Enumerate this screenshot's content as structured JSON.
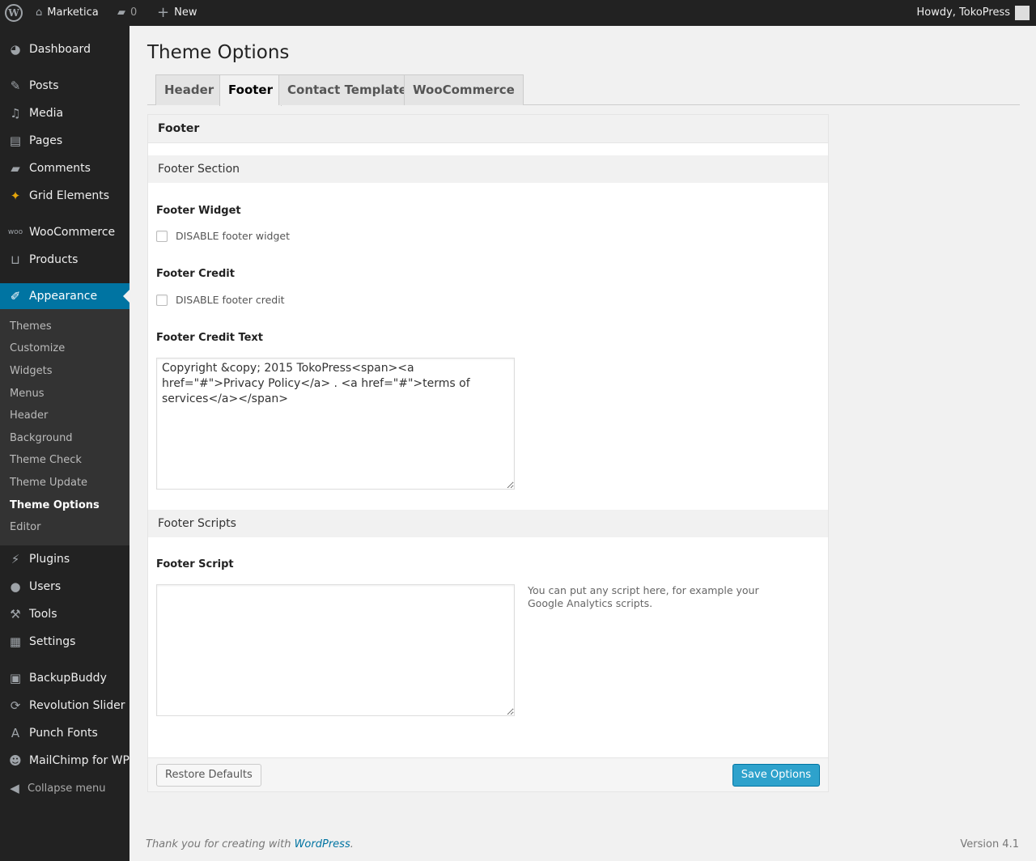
{
  "adminbar": {
    "site": "Marketica",
    "comments": "0",
    "new": "New",
    "howdy": "Howdy, TokoPress"
  },
  "menu": {
    "dashboard": "Dashboard",
    "posts": "Posts",
    "media": "Media",
    "pages": "Pages",
    "comments": "Comments",
    "grid": "Grid Elements",
    "woocommerce": "WooCommerce",
    "products": "Products",
    "appearance": "Appearance",
    "plugins": "Plugins",
    "users": "Users",
    "tools": "Tools",
    "settings": "Settings",
    "backupbuddy": "BackupBuddy",
    "revslider": "Revolution Slider",
    "punchfonts": "Punch Fonts",
    "mailchimp": "MailChimp for WP",
    "collapse": "Collapse menu"
  },
  "submenu": [
    "Themes",
    "Customize",
    "Widgets",
    "Menus",
    "Header",
    "Background",
    "Theme Check",
    "Theme Update",
    "Theme Options",
    "Editor"
  ],
  "page": {
    "title": "Theme Options",
    "tabs": [
      "Header",
      "Footer",
      "Contact Template",
      "WooCommerce"
    ],
    "active_tab": "Footer"
  },
  "panel": {
    "heading": "Footer",
    "section1": "Footer Section",
    "widget_label": "Footer Widget",
    "widget_cb": "DISABLE footer widget",
    "credit_label": "Footer Credit",
    "credit_cb": "DISABLE footer credit",
    "credit_text_label": "Footer Credit Text",
    "credit_text": "Copyright &copy; 2015 TokoPress<span><a href=\"#\">Privacy Policy</a> . <a href=\"#\">terms of services</a></span>",
    "section2": "Footer Scripts",
    "script_label": "Footer Script",
    "script_value": "",
    "script_desc": "You can put any script here, for example your Google Analytics scripts.",
    "restore": "Restore Defaults",
    "save": "Save Options"
  },
  "footer": {
    "thanks": "Thank you for creating with ",
    "wp": "WordPress",
    "dot": ".",
    "version": "Version 4.1"
  },
  "colors": {
    "accent": "#0074a2",
    "button": "#2ea2cc",
    "adminbar": "#222222"
  }
}
